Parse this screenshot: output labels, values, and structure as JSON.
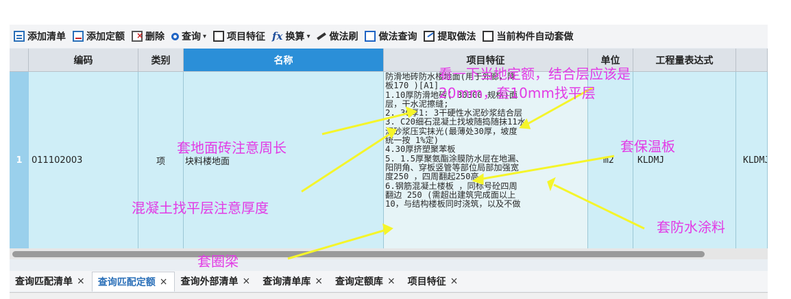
{
  "toolbar": {
    "add_list": "添加清单",
    "add_quota": "添加定额",
    "delete": "删除",
    "query": "查询",
    "item_feature": "项目特征",
    "convert": "换算",
    "method_brush": "做法刷",
    "method_query": "做法查询",
    "extract_method": "提取做法",
    "auto_apply": "当前构件自动套做"
  },
  "table": {
    "headers": {
      "code": "编码",
      "category": "类别",
      "name": "名称",
      "feature": "项目特征",
      "unit": "单位",
      "expr": "工程量表达式"
    },
    "row": {
      "num": "1",
      "code": "011102003",
      "category": "项",
      "name": "块料楼地面",
      "feature_lines": [
        "防滑地砖防水楼地面(用于外廊，降",
        "板170 )[A1]",
        "1.10厚防滑地砖( 30300 规格)面",
        "层，干水泥擦缝;",
        "2. 30厚1: 3干硬性水泥砂浆结合层",
        "3. C20细石混凝土找坡随捣随抹11水",
        "泥砂浆压实抹光(最薄处30厚，坡度",
        "统一按 1%定)",
        "4.30厚挤塑聚苯板",
        "5. 1.5厚聚氨酯涂膜防水层在地漏、",
        "阳阴角、穿板竖管等部位局部加强宽",
        "度250 ，四周翻起250高",
        "6.钢筋混凝土楼板 ，同标号砼四周",
        "翻边 250 (需超出建筑完成面以上",
        "10，与结构楼板同时浇筑，以及不做"
      ],
      "unit": "m2",
      "expr": "KLDMJ",
      "extra": "KLDMJ"
    }
  },
  "tabs": [
    {
      "label": "查询匹配清单",
      "close": "×"
    },
    {
      "label": "查询匹配定额",
      "close": "×"
    },
    {
      "label": "查询外部清单",
      "close": "×"
    },
    {
      "label": "查询清单库",
      "close": "×"
    },
    {
      "label": "查询定额库",
      "close": "×"
    },
    {
      "label": "项目特征",
      "close": "×"
    }
  ],
  "annotations": {
    "top_note_1": "看一下当地定额，结合层应该是",
    "top_note_2": "20mm，套10mm找平层",
    "floor_tile": "套地面砖注意周长",
    "insulation": "套保温板",
    "concrete": "混凝土找平层注意厚度",
    "waterproof": "套防水涂料",
    "ring_beam": "套圈梁"
  },
  "colors": {
    "annotation": "#e23be5",
    "arrow": "#f5f52a",
    "selected_header": "#2b8fd8",
    "row_bg": "#cfeef7"
  }
}
